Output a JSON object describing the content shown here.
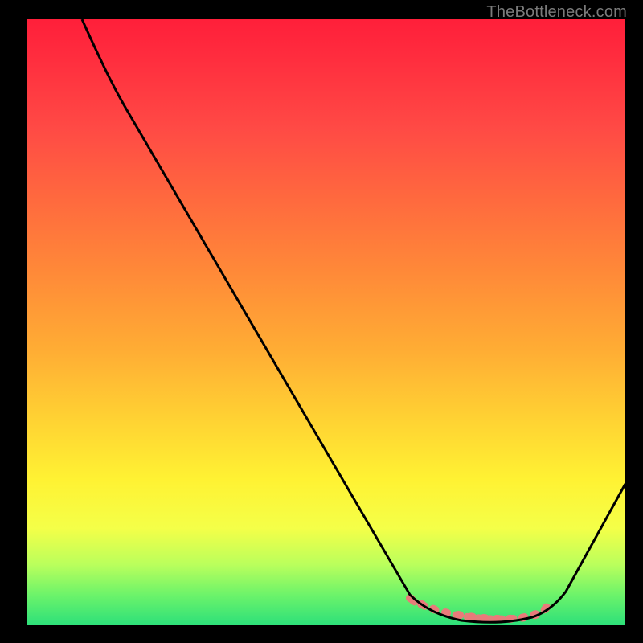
{
  "watermark": "TheBottleneck.com",
  "chart_data": {
    "type": "line",
    "title": "",
    "xlabel": "",
    "ylabel": "",
    "xlim": [
      0,
      100
    ],
    "ylim": [
      0,
      100
    ],
    "series": [
      {
        "name": "curve",
        "x": [
          0,
          6,
          12,
          18,
          24,
          30,
          36,
          42,
          48,
          54,
          60,
          64,
          68,
          72,
          76,
          80,
          84,
          88,
          92,
          96,
          100
        ],
        "y": [
          100,
          95,
          88.5,
          81,
          73,
          65,
          57,
          49,
          41,
          33,
          25,
          18,
          11,
          5,
          1.5,
          0.5,
          0.5,
          2,
          7,
          15,
          24
        ]
      },
      {
        "name": "minimum-band",
        "x": [
          64,
          66,
          68,
          70,
          72,
          74,
          76,
          78,
          80,
          82,
          84,
          86,
          88
        ],
        "y": [
          4.5,
          3.5,
          2.8,
          2.2,
          1.8,
          1.5,
          1.3,
          1.3,
          1.5,
          1.8,
          2.4,
          3.2,
          4.2
        ]
      }
    ],
    "colors": {
      "curve": "#000000",
      "band": "#e97a7a"
    },
    "background_gradient_top": "#ff1f3a",
    "background_gradient_bottom": "#2de07a"
  }
}
